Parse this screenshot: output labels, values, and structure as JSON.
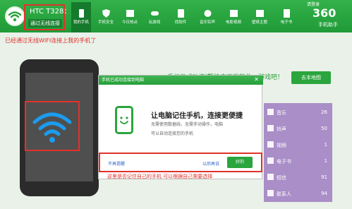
{
  "header": {
    "device_name": "HTC T328t",
    "connection_mode": "通过无线连接",
    "nav": [
      {
        "label": "我的手机"
      },
      {
        "label": "手机安全"
      },
      {
        "label": "今日热点"
      },
      {
        "label": "玩游戏"
      },
      {
        "label": "找软件"
      },
      {
        "label": "音乐铃声"
      },
      {
        "label": "电影视频"
      },
      {
        "label": "壁纸主题"
      },
      {
        "label": "电子书"
      }
    ],
    "logo_main": "360",
    "logo_sub": "手机助手",
    "window_controls": "请登录"
  },
  "notice": "已经通过无线WIFI连接上我的手机了",
  "banner": {
    "left": "手机已成功连接，",
    "right": "轻快去下载软件、游戏吧！",
    "button": "去本地图"
  },
  "sidebar": {
    "items": [
      {
        "label": "音乐",
        "count": "26"
      },
      {
        "label": "铃声",
        "count": "50"
      },
      {
        "label": "视频",
        "count": "1"
      },
      {
        "label": "电子书",
        "count": "1"
      },
      {
        "label": "短信",
        "count": "91"
      },
      {
        "label": "联系人",
        "count": "94"
      }
    ]
  },
  "dialog": {
    "title": "手机已成功连接到电脑",
    "heading": "让电脑记住手机，连接更便捷",
    "desc_line1": "无需使用数据线，无需手动操作，电脑",
    "desc_line2": "可以自动连接您的手机",
    "no_remind": "不再提醒",
    "later": "以后再说",
    "ok": "好的"
  },
  "annotation_bottom": "这里是否记住自己的手机 可以根据自己需要选择",
  "colors": {
    "brand_green": "#2ba53d",
    "annotation_red": "#e0322b",
    "sidebar_purple": "#a98ec7"
  }
}
